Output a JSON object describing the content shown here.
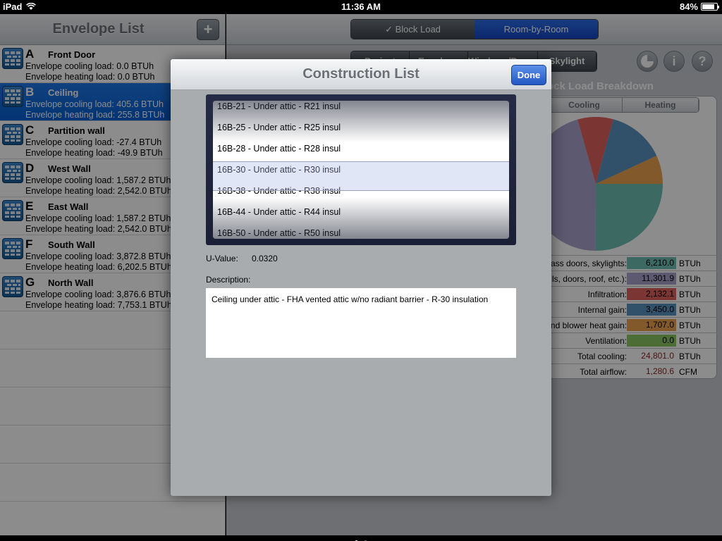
{
  "status": {
    "device": "iPad",
    "time": "11:36 AM",
    "battery": "84%",
    "battery_level": 0.84
  },
  "envelope": {
    "title": "Envelope List",
    "add_label": "+",
    "items": [
      {
        "letter": "A",
        "name": "Front Door",
        "cooling": "Envelope cooling load: 0.0 BTUh",
        "heating": "Envelope heating load: 0.0 BTUh"
      },
      {
        "letter": "B",
        "name": "Ceiling",
        "cooling": "Envelope cooling load: 405.6 BTUh",
        "heating": "Envelope heating load: 255.8 BTUh"
      },
      {
        "letter": "C",
        "name": "Partition wall",
        "cooling": "Envelope cooling load: -27.4 BTUh",
        "heating": "Envelope heating load: -49.9 BTUh"
      },
      {
        "letter": "D",
        "name": "West Wall",
        "cooling": "Envelope cooling load: 1,587.2 BTUh",
        "heating": "Envelope heating load: 2,542.0 BTUh"
      },
      {
        "letter": "E",
        "name": "East Wall",
        "cooling": "Envelope cooling load: 1,587.2 BTUh",
        "heating": "Envelope heating load: 2,542.0 BTUh"
      },
      {
        "letter": "F",
        "name": "South Wall",
        "cooling": "Envelope cooling load: 3,872.8 BTUh",
        "heating": "Envelope heating load: 6,202.5 BTUh"
      },
      {
        "letter": "G",
        "name": "North Wall",
        "cooling": "Envelope cooling load: 3,876.6 BTUh",
        "heating": "Envelope heating load: 7,753.1 BTUh"
      }
    ]
  },
  "main": {
    "seg": {
      "block": "✓ Block Load",
      "room": "Room-by-Room"
    },
    "sub_tabs": [
      "Project",
      "Envelope",
      "Windows/Doors",
      "Skylight"
    ],
    "icons": {
      "chart": "pie-chart-icon",
      "info": "i",
      "help": "?"
    },
    "breakdown_title": "Block Load Breakdown",
    "cool_heat": {
      "cooling": "Cooling",
      "heating": "Heating"
    },
    "rows": [
      {
        "label": "Windows, glass doors, skylights:",
        "value": "6,210.0",
        "unit": "BTUh",
        "color": "#6fc0b4"
      },
      {
        "label": "Walls, doors, roof, etc.):",
        "value": "11,301.9",
        "unit": "BTUh",
        "color": "#a8a3cc"
      },
      {
        "label": "Infiltration:",
        "value": "2,132.1",
        "unit": "BTUh",
        "color": "#e0625d"
      },
      {
        "label": "Internal gain:",
        "value": "3,450.0",
        "unit": "BTUh",
        "color": "#5a93c2"
      },
      {
        "label": "Duct and blower heat gain:",
        "value": "1,707.0",
        "unit": "BTUh",
        "color": "#eba24f"
      },
      {
        "label": "Ventilation:",
        "value": "0.0",
        "unit": "BTUh",
        "color": "#8dc663"
      },
      {
        "label": "Total cooling:",
        "value": "24,801.0",
        "unit": "BTUh",
        "color": ""
      },
      {
        "label": "Total airflow:",
        "value": "1,280.6",
        "unit": "CFM",
        "color": ""
      }
    ]
  },
  "modal": {
    "title": "Construction List",
    "done_label": "Done",
    "picker_items": [
      "16B-21 - Under attic - R21 insul",
      "16B-25 - Under attic - R25 insul",
      "16B-28 - Under attic - R28 insul",
      "16B-30 - Under attic - R30 insul",
      "16B-38 - Under attic - R38 insul",
      "16B-44 - Under attic - R44 insul",
      "16B-50 - Under attic - R50 insul"
    ],
    "selected_index": 3,
    "uvalue_label": "U-Value:",
    "uvalue": "0.0320",
    "description_label": "Description:",
    "description": "Ceiling under attic - FHA vented attic w/no radiant barrier - R-30 insulation"
  },
  "chart_data": {
    "type": "pie",
    "categories": [
      "Windows, glass doors, skylights",
      "Walls, doors, roof, etc.",
      "Infiltration",
      "Internal gain",
      "Duct and blower heat gain",
      "Ventilation"
    ],
    "values": [
      6210.0,
      11301.9,
      2132.1,
      3450.0,
      1707.0,
      0.0
    ],
    "colors": [
      "#6fc0b4",
      "#a8a3cc",
      "#e0625d",
      "#5a93c2",
      "#eba24f",
      "#8dc663"
    ]
  }
}
